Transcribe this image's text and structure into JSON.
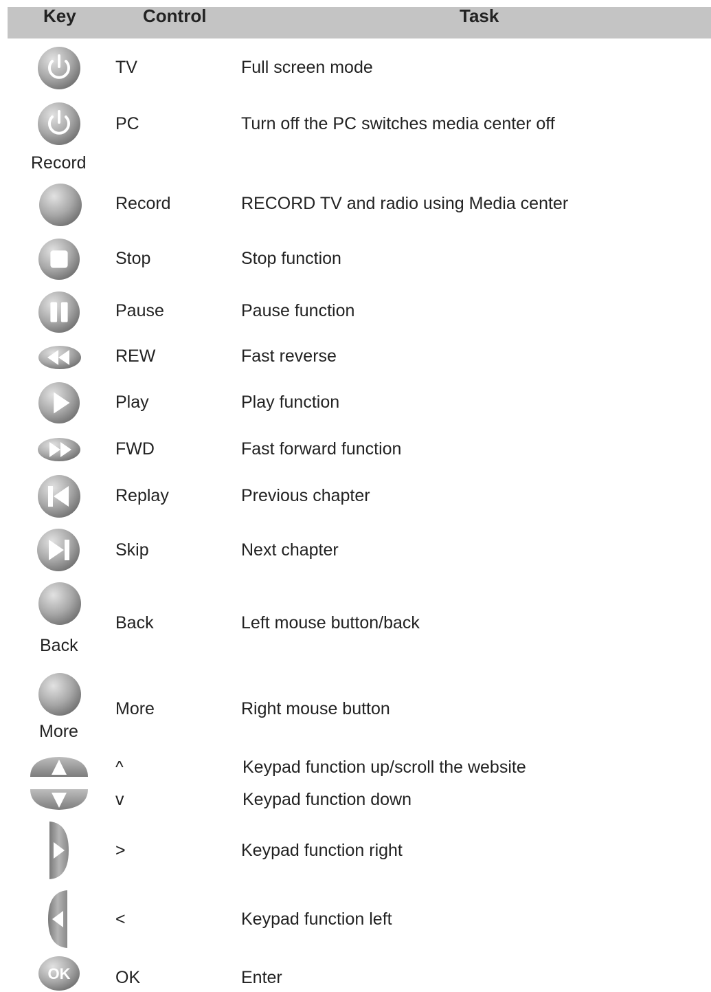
{
  "header": {
    "key": "Key",
    "control": "Control",
    "task": "Task"
  },
  "rows": [
    {
      "icon": "power-icon",
      "control": "TV",
      "task": "Full screen mode"
    },
    {
      "icon": "power-icon",
      "control": "PC",
      "task": "Turn off the PC switches media center off",
      "caption": "Record"
    },
    {
      "icon": "record-icon",
      "control": "Record",
      "task": "RECORD TV and radio using Media center"
    },
    {
      "icon": "stop-icon",
      "control": "Stop",
      "task": "Stop function"
    },
    {
      "icon": "pause-icon",
      "control": "Pause",
      "task": "Pause function"
    },
    {
      "icon": "rewind-icon",
      "control": "REW",
      "task": "Fast reverse"
    },
    {
      "icon": "play-icon",
      "control": "Play",
      "task": "Play function"
    },
    {
      "icon": "fast-forward-icon",
      "control": "FWD",
      "task": "Fast forward function"
    },
    {
      "icon": "previous-icon",
      "control": "Replay",
      "task": "Previous chapter"
    },
    {
      "icon": "next-icon",
      "control": "Skip",
      "task": "Next chapter"
    },
    {
      "icon": "round-button-icon",
      "control": "Back",
      "task": "Left mouse button/back",
      "caption": "Back"
    },
    {
      "icon": "round-button-icon",
      "control": "More",
      "task": "Right mouse button",
      "caption": "More"
    },
    {
      "icon": "up-arrow-icon",
      "control": "^",
      "task": "Keypad function up/scroll the website"
    },
    {
      "icon": "down-arrow-icon",
      "control": "v",
      "task": "Keypad function down"
    },
    {
      "icon": "right-arrow-icon",
      "control": ">",
      "task": "Keypad function right"
    },
    {
      "icon": "left-arrow-icon",
      "control": "<",
      "task": "Keypad function left"
    },
    {
      "icon": "ok-icon",
      "control": "OK",
      "task": "Enter",
      "icon_text": "OK"
    }
  ]
}
